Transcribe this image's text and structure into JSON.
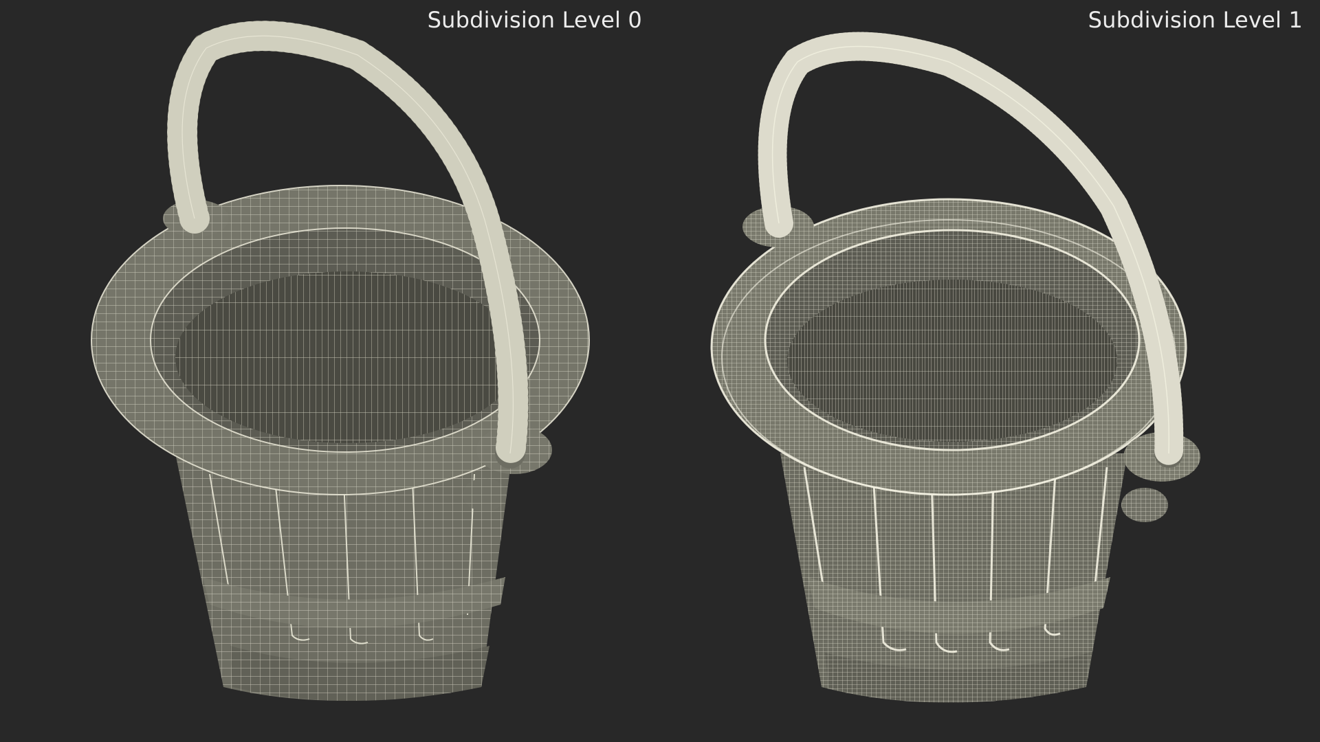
{
  "viewports": [
    {
      "label": "Subdivision Level 0",
      "subdivision_level": 0
    },
    {
      "label": "Subdivision Level 1",
      "subdivision_level": 1
    }
  ],
  "colors": {
    "background": "#282828",
    "caption_text": "#ececec",
    "mesh_surface": "#6d6d62",
    "mesh_interior": "#4a4a42",
    "wireframe": "#e9e7d6"
  },
  "subject": "bucket-wireframe-render"
}
